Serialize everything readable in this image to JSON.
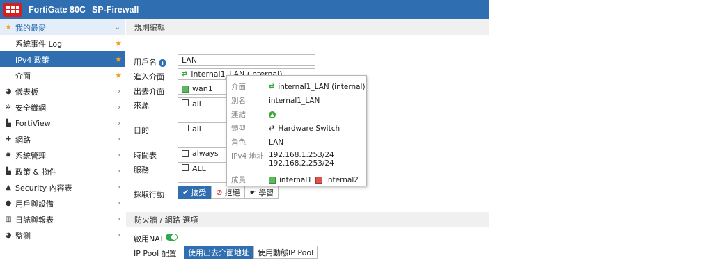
{
  "header": {
    "brand": "FortiGate 80C",
    "device": "SP-Firewall"
  },
  "sidebar": {
    "items": [
      {
        "label": "我的最愛",
        "icon": "star-icon",
        "trail": "chevron-down"
      },
      {
        "label": "系統事件 Log",
        "trail": "star"
      },
      {
        "label": "IPv4 政策",
        "trail": "star"
      },
      {
        "label": "介面",
        "trail": "star"
      },
      {
        "label": "儀表板",
        "icon": "dashboard-icon",
        "trail": "chevron-right"
      },
      {
        "label": "安全織網",
        "icon": "security-fabric-icon",
        "trail": "chevron-right"
      },
      {
        "label": "FortiView",
        "icon": "fortiview-icon",
        "trail": "chevron-right"
      },
      {
        "label": "網路",
        "icon": "network-icon",
        "trail": "chevron-right"
      },
      {
        "label": "系統管理",
        "icon": "gear-icon",
        "trail": "chevron-right"
      },
      {
        "label": "政策 & 物件",
        "icon": "policy-icon",
        "trail": "chevron-right"
      },
      {
        "label": "Security 內容表",
        "icon": "lock-icon",
        "trail": "chevron-right"
      },
      {
        "label": "用戶與設備",
        "icon": "user-icon",
        "trail": "chevron-right"
      },
      {
        "label": "日誌與報表",
        "icon": "chart-icon",
        "trail": "chevron-right"
      },
      {
        "label": "監測",
        "icon": "monitor-icon",
        "trail": "chevron-right"
      }
    ]
  },
  "section": {
    "rule_edit": "規則編輯",
    "firewall_options": "防火牆 / 網路 選項"
  },
  "form": {
    "name_label": "用戶名",
    "name_value": "LAN",
    "incoming_label": "進入介面",
    "incoming_value": "internal1_LAN (internal)",
    "outgoing_label": "出去介面",
    "outgoing_value": "wan1",
    "source_label": "來源",
    "source_value": "all",
    "destination_label": "目的",
    "destination_value": "all",
    "schedule_label": "時間表",
    "schedule_value": "always",
    "service_label": "服務",
    "service_value": "ALL",
    "action_label": "採取行動",
    "action_accept": "接受",
    "action_deny": "拒絕",
    "action_learn": "學習",
    "nat_label": "啟用NAT",
    "nat_enabled": true,
    "ippool_label": "IP Pool 配置",
    "ippool_outgoing": "使用出去介面地址",
    "ippool_dynamic": "使用動態IP Pool"
  },
  "popup": {
    "interface_key": "介面",
    "interface_val": "internal1_LAN (internal)",
    "alias_key": "別名",
    "alias_val": "internal1_LAN",
    "link_key": "連結",
    "type_key": "類型",
    "type_val": "Hardware Switch",
    "role_key": "角色",
    "role_val": "LAN",
    "ipv4_key": "IPv4 地址",
    "ipv4_val1": "192.168.1.253/24",
    "ipv4_val2": "192.168.2.253/24",
    "members_key": "成員",
    "member1": "internal1",
    "member2": "internal2"
  },
  "colors": {
    "header_blue": "#2f6eb1",
    "logo_red": "#d62020",
    "toggle_green": "#2fa84f",
    "star_orange": "#f0a020"
  }
}
